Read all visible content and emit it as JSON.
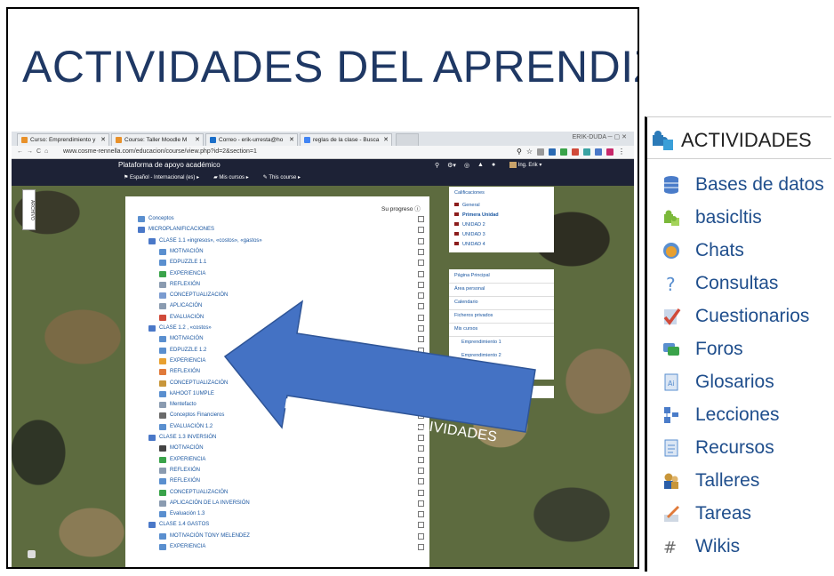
{
  "slide": {
    "title": "ACTIVIDADES DEL APRENDIZAJE",
    "arrow_text": "DIVERSIDAD DE ACTIVIDADES"
  },
  "browser": {
    "tabs": [
      {
        "label": "Curso: Emprendimiento y",
        "color": "#e8912a"
      },
      {
        "label": "Course: Taller Moodle M",
        "color": "#e8912a"
      },
      {
        "label": "Correo - erik-urresta@ho",
        "color": "#1c6fc9"
      },
      {
        "label": "reglas de la clase - Busca",
        "color": "#4285f4"
      }
    ],
    "window_label": "ERIK-DUDA",
    "url": "www.cosme-rennella.com/educacion/course/view.php?id=2&section=1"
  },
  "moodle": {
    "site_name": "Plataforma de apoyo académico",
    "menu": [
      "Español - Internacional (es)",
      "Mis cursos",
      "This course"
    ],
    "user": "Ing. Erik",
    "progress_label": "Su progreso",
    "side_tab": "ARCHIVO",
    "course_items": [
      {
        "label": "Conceptos",
        "level": 0,
        "icon": "forum-icon",
        "color": "#5a8fcf"
      },
      {
        "label": "MICROPLANIFICACIONES",
        "level": 0,
        "icon": "folder-icon",
        "color": "#4a78c8"
      },
      {
        "label": "CLASE 1.1 «ingresos», «costos», «gastos»",
        "level": 1,
        "icon": "folder-icon",
        "color": "#4a78c8"
      },
      {
        "label": "MOTIVACIÓN",
        "level": 2,
        "icon": "page-icon",
        "color": "#5a8fcf"
      },
      {
        "label": "EDPUZZLE 1.1",
        "level": 2,
        "icon": "page-icon",
        "color": "#5a8fcf"
      },
      {
        "label": "EXPERIENCIA",
        "level": 2,
        "icon": "chat-icon",
        "color": "#3aa34a"
      },
      {
        "label": "REFLEXIÓN",
        "level": 2,
        "icon": "workshop-icon",
        "color": "#8a9bb0"
      },
      {
        "label": "CONCEPTUALIZACIÓN",
        "level": 2,
        "icon": "page-icon",
        "color": "#7a9bd0"
      },
      {
        "label": "APLICACIÓN",
        "level": 2,
        "icon": "assign-icon",
        "color": "#8a9bb0"
      },
      {
        "label": "EVALUACIÓN",
        "level": 2,
        "icon": "quiz-icon",
        "color": "#d04a3a"
      },
      {
        "label": "CLASE 1.2 , «costos»",
        "level": 1,
        "icon": "folder-icon",
        "color": "#4a78c8"
      },
      {
        "label": "MOTIVACIÓN",
        "level": 2,
        "icon": "page-icon",
        "color": "#5a8fcf"
      },
      {
        "label": "EDPUZZLE 1.2",
        "level": 2,
        "icon": "page-icon",
        "color": "#5a8fcf"
      },
      {
        "label": "EXPERIENCIA",
        "level": 2,
        "icon": "chat-icon",
        "color": "#e8a030"
      },
      {
        "label": "REFLEXIÓN",
        "level": 2,
        "icon": "lesson-icon",
        "color": "#e07a3a"
      },
      {
        "label": "CONCEPTUALIZACIÓN",
        "level": 2,
        "icon": "workshop-icon",
        "color": "#c8963a"
      },
      {
        "label": "kAHOOT 1UMPLE",
        "level": 2,
        "icon": "page-icon",
        "color": "#5a8fcf"
      },
      {
        "label": "Mentefacto",
        "level": 2,
        "icon": "assign-icon",
        "color": "#8a9bb0"
      },
      {
        "label": "Conceptos Financieros",
        "level": 2,
        "icon": "wiki-icon",
        "color": "#6a6a6a"
      },
      {
        "label": "EVALUACIÓN 1.2",
        "level": 2,
        "icon": "page-icon",
        "color": "#5a8fcf"
      },
      {
        "label": "CLASE 1.3 INVERSIÓN",
        "level": 1,
        "icon": "folder-icon",
        "color": "#4a78c8"
      },
      {
        "label": "MOTIVACIÓN",
        "level": 2,
        "icon": "ball-icon",
        "color": "#444444"
      },
      {
        "label": "EXPERIENCIA",
        "level": 2,
        "icon": "chat-icon",
        "color": "#3aa34a"
      },
      {
        "label": "REFLEXIÓN",
        "level": 2,
        "icon": "workshop-icon",
        "color": "#8a9bb0"
      },
      {
        "label": "REFLEXIÓN",
        "level": 2,
        "icon": "question-icon",
        "color": "#5a8fcf"
      },
      {
        "label": "CONCEPTUALIZACIÓN",
        "level": 2,
        "icon": "chat-icon",
        "color": "#3aa34a"
      },
      {
        "label": "APLICACIÓN DE LA INVERSIÓN",
        "level": 2,
        "icon": "assign-icon",
        "color": "#8a9bb0"
      },
      {
        "label": "Evaluación 1.3",
        "level": 2,
        "icon": "page-icon",
        "color": "#5a8fcf"
      },
      {
        "label": "CLASE 1.4 GASTOS",
        "level": 1,
        "icon": "folder-icon",
        "color": "#4a78c8"
      },
      {
        "label": "MOTIVACIÓN TONY MELENDEZ",
        "level": 2,
        "icon": "page-icon",
        "color": "#5a8fcf"
      },
      {
        "label": "EXPERIENCIA",
        "level": 2,
        "icon": "page-icon",
        "color": "#5a8fcf"
      }
    ],
    "grades": {
      "title": "Calificaciones",
      "items": [
        "General",
        "Primera Unidad",
        "UNIDAD 2",
        "UNIDAD 3",
        "UNIDAD 4"
      ]
    },
    "navigation": {
      "items": [
        "Página Principal",
        "Área personal",
        "Calendario",
        "Ficheros privados",
        "Mis cursos"
      ],
      "courses": [
        "Emprendimiento 1",
        "Emprendimiento 2",
        "EMPRENDIMIENTO"
      ]
    }
  },
  "activities_panel": {
    "title": "ACTIVIDADES",
    "items": [
      {
        "label": "Bases de datos",
        "icon": "database-icon",
        "color": "#4a7cc9"
      },
      {
        "label": "basicltis",
        "icon": "puzzle-icon",
        "color": "#7bb83a"
      },
      {
        "label": "Chats",
        "icon": "chat-icon",
        "color": "#e8a030"
      },
      {
        "label": "Consultas",
        "icon": "question-icon",
        "color": "#5a8fcf"
      },
      {
        "label": "Cuestionarios",
        "icon": "quiz-icon",
        "color": "#d04a3a"
      },
      {
        "label": "Foros",
        "icon": "forum-icon",
        "color": "#3aa34a"
      },
      {
        "label": "Glosarios",
        "icon": "glossary-icon",
        "color": "#5a8fcf"
      },
      {
        "label": "Lecciones",
        "icon": "lesson-icon",
        "color": "#4a7cc9"
      },
      {
        "label": "Recursos",
        "icon": "resource-icon",
        "color": "#5a8fcf"
      },
      {
        "label": "Talleres",
        "icon": "workshop-icon",
        "color": "#c8963a"
      },
      {
        "label": "Tareas",
        "icon": "assign-icon",
        "color": "#e07a3a"
      },
      {
        "label": "Wikis",
        "icon": "wiki-icon",
        "color": "#6a6a6a"
      }
    ]
  }
}
